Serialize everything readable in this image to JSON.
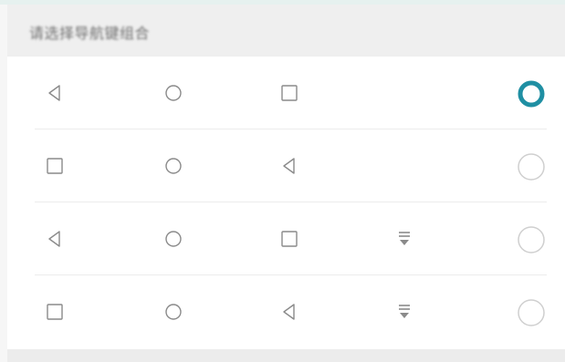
{
  "header": {
    "title": "请选择导航键组合"
  },
  "colors": {
    "accent": "#1f8fa3",
    "icon_stroke": "#8a8a8a",
    "radio_unselected": "#cfcfcf"
  },
  "options": [
    {
      "icons": [
        "back-icon",
        "home-icon",
        "recents-icon"
      ],
      "selected": true
    },
    {
      "icons": [
        "recents-icon",
        "home-icon",
        "back-icon"
      ],
      "selected": false
    },
    {
      "icons": [
        "back-icon",
        "home-icon",
        "recents-icon",
        "notification-pulldown-icon"
      ],
      "selected": false
    },
    {
      "icons": [
        "recents-icon",
        "home-icon",
        "back-icon",
        "notification-pulldown-icon"
      ],
      "selected": false
    }
  ]
}
